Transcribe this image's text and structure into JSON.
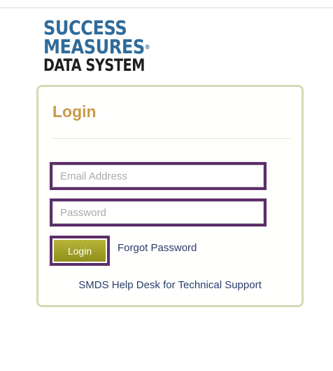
{
  "logo": {
    "line1": "SUCCESS",
    "line2": "MEASURES",
    "line2_mark": "®",
    "line3": "DATA SYSTEM"
  },
  "login_panel": {
    "title": "Login",
    "email_placeholder": "Email Address",
    "password_placeholder": "Password",
    "login_button": "Login",
    "forgot_password_link": "Forgot Password",
    "helpdesk_link": "SMDS Help Desk for Technical Support"
  },
  "colors": {
    "logo_blue": "#2f6b9a",
    "title_gold": "#c79b46",
    "highlight_purple": "#5d2e6a",
    "button_olive": "#a3a12a",
    "link_blue": "#2a3d6a"
  }
}
